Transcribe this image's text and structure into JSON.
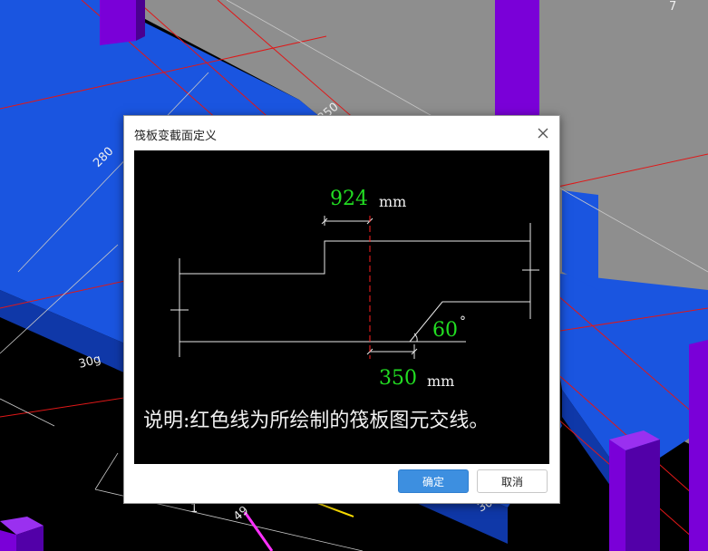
{
  "dialog": {
    "title": "筏板变截面定义",
    "ok_label": "确定",
    "cancel_label": "取消"
  },
  "preview": {
    "top_width_value": "924",
    "top_width_unit": "mm",
    "bottom_width_value": "350",
    "bottom_width_unit": "mm",
    "angle_value": "60",
    "angle_unit": "°",
    "note": "说明:红色线为所绘制的筏板图元交线。"
  },
  "background": {
    "labels": [
      "280",
      "30g",
      "250",
      "7",
      "1",
      "49",
      "300"
    ]
  },
  "colors": {
    "accent": "#3d8fe0",
    "dimension_text": "#22dd22",
    "intersection_line": "#ff2020",
    "slab": "#1a55e0",
    "column": "#7a00d8",
    "ground": "#8e8e8e"
  }
}
